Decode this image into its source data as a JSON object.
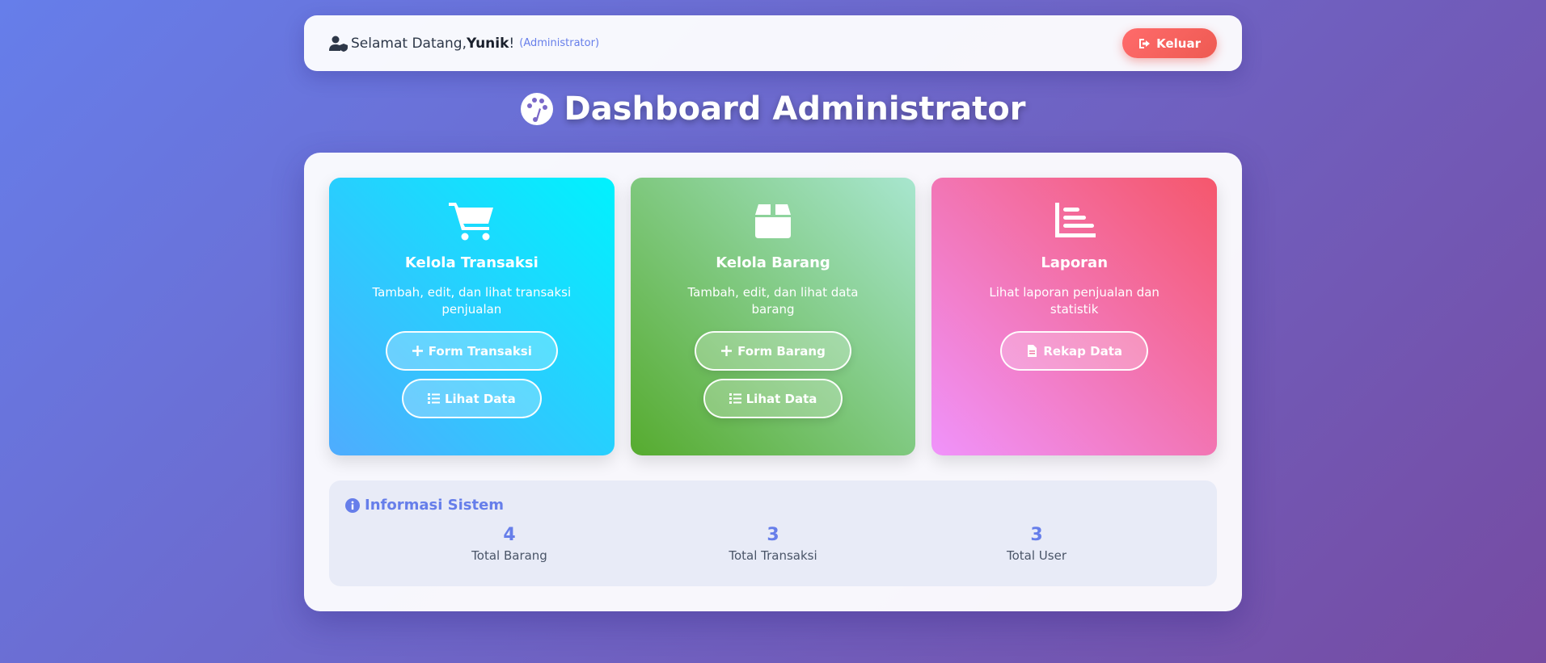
{
  "header": {
    "greeting": "Selamat Datang, ",
    "username": "Yunik",
    "exclaim": "!",
    "role": "(Administrator)",
    "logout_label": "Keluar",
    "user_icon": "user-shield-icon",
    "logout_icon": "sign-out-icon"
  },
  "page": {
    "title": "Dashboard Administrator",
    "title_icon": "palette-icon"
  },
  "cards": [
    {
      "icon": "shopping-cart-icon",
      "title": "Kelola Transaksi",
      "desc": "Tambah, edit, dan lihat transaksi penjualan",
      "buttons": [
        {
          "label": "Form Transaksi",
          "icon": "plus-icon"
        },
        {
          "label": "Lihat Data",
          "icon": "list-icon"
        }
      ]
    },
    {
      "icon": "box-icon",
      "title": "Kelola Barang",
      "desc": "Tambah, edit, dan lihat data barang",
      "buttons": [
        {
          "label": "Form Barang",
          "icon": "plus-icon"
        },
        {
          "label": "Lihat Data",
          "icon": "list-icon"
        }
      ]
    },
    {
      "icon": "chart-bar-icon",
      "title": "Laporan",
      "desc": "Lihat laporan penjualan dan statistik",
      "buttons": [
        {
          "label": "Rekap Data",
          "icon": "file-icon"
        }
      ]
    }
  ],
  "info": {
    "title": "Informasi Sistem",
    "icon": "info-circle-icon",
    "stats": [
      {
        "value": "4",
        "label": "Total Barang"
      },
      {
        "value": "3",
        "label": "Total Transaksi"
      },
      {
        "value": "3",
        "label": "Total User"
      }
    ]
  },
  "colors": {
    "accent": "#667eea",
    "logout": "#ee5a52",
    "card_blue": "#4facfe",
    "card_green": "#56ab2f",
    "card_pink": "#f5576c"
  }
}
